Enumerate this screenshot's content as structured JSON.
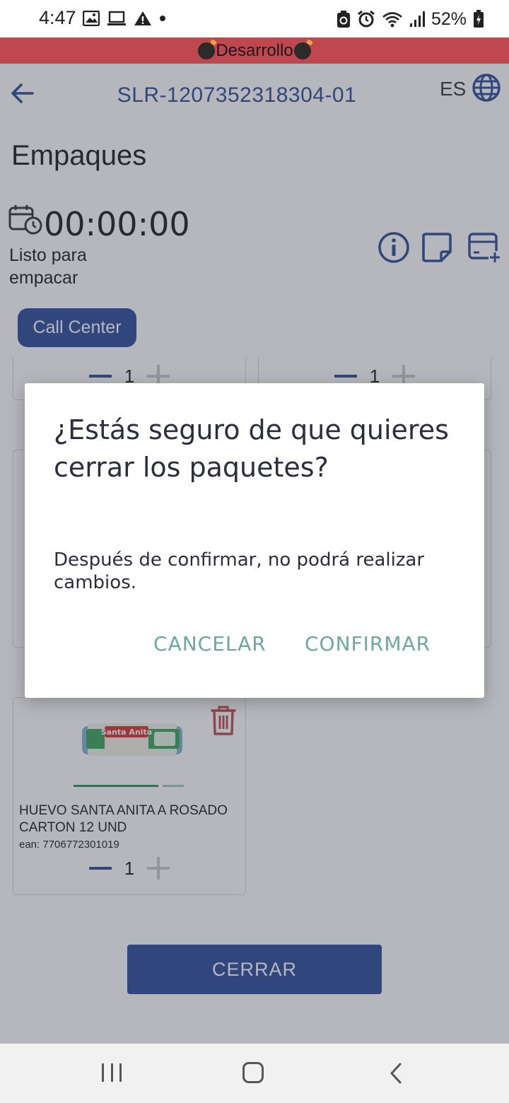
{
  "status_bar": {
    "time": "4:47",
    "battery": "52%",
    "left_icons": [
      "image-icon",
      "laptop-icon",
      "warning-icon",
      "dot-icon"
    ],
    "right_icons": [
      "recycle-icon",
      "alarm-icon",
      "wifi-icon",
      "signal-icon",
      "battery-icon"
    ]
  },
  "dev_banner": {
    "label": "Desarrollo",
    "color": "#c0474f"
  },
  "header": {
    "title": "SLR-1207352318304-01",
    "language": "ES"
  },
  "page": {
    "title": "Empaques",
    "timer": "00:00:00",
    "status": "Listo para empacar",
    "call_center_label": "Call Center",
    "close_button_label": "CERRAR"
  },
  "products": [
    {
      "qty": "1"
    },
    {
      "qty": "1"
    },
    {
      "name": "HUEVO SANTA ANITA A ROSADO CARTON 12 UND",
      "ean": "ean: 7706772301019",
      "qty": "1",
      "image_brand": "Santa Anita"
    }
  ],
  "dialog": {
    "title": "¿Estás seguro de que quieres cerrar los paquetes?",
    "body": "Después de confirmar, no podrá realizar cambios.",
    "cancel_label": "CANCELAR",
    "confirm_label": "CONFIRMAR"
  },
  "colors": {
    "primary": "#2b4a9a",
    "dialog_action": "#6ea79c",
    "danger": "#c0474f"
  }
}
